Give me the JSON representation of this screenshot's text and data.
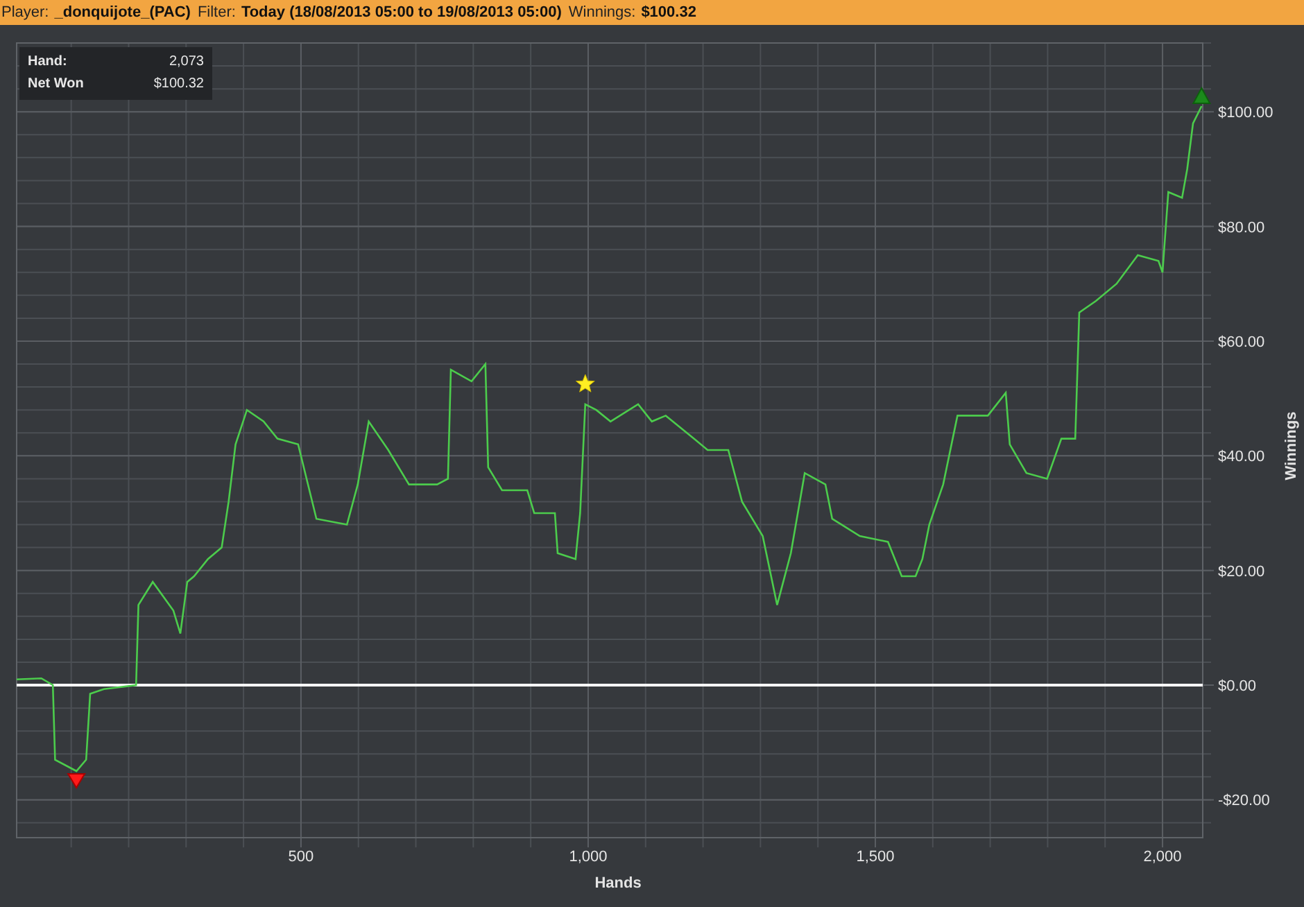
{
  "header": [
    {
      "label": "Player:",
      "value": "_donquijote_(PAC)"
    },
    {
      "label": "Filter:",
      "value": "Today (18/08/2013 05:00 to 19/08/2013 05:00)"
    },
    {
      "label": "Winnings:",
      "value": "$100.32"
    }
  ],
  "info_box": [
    {
      "label": "Hand:",
      "value": "2,073"
    },
    {
      "label": "Net Won",
      "value": "$100.32"
    }
  ],
  "chart_data": {
    "type": "line",
    "xlabel": "Hands",
    "ylabel": "Winnings",
    "xlim": [
      5,
      2070
    ],
    "ylim": [
      -26.6,
      112
    ],
    "xticks": [
      {
        "value": 500,
        "label": "500"
      },
      {
        "value": 1000,
        "label": "1,000"
      },
      {
        "value": 1500,
        "label": "1,500"
      },
      {
        "value": 2000,
        "label": "2,000"
      }
    ],
    "yticks": [
      {
        "value": -20,
        "label": "-$20.00"
      },
      {
        "value": 0,
        "label": "$0.00"
      },
      {
        "value": 20,
        "label": "$20.00"
      },
      {
        "value": 40,
        "label": "$40.00"
      },
      {
        "value": 60,
        "label": "$60.00"
      },
      {
        "value": 80,
        "label": "$80.00"
      },
      {
        "value": 100,
        "label": "$100.00"
      }
    ],
    "x": [
      5,
      48,
      68,
      72,
      109,
      126,
      133,
      157,
      213,
      217,
      242,
      278,
      290,
      302,
      314,
      338,
      362,
      374,
      386,
      406,
      435,
      459,
      495,
      527,
      580,
      599,
      618,
      652,
      688,
      737,
      756,
      761,
      797,
      821,
      826,
      850,
      894,
      906,
      942,
      947,
      978,
      986,
      995,
      1014,
      1039,
      1087,
      1111,
      1135,
      1184,
      1208,
      1244,
      1268,
      1304,
      1329,
      1353,
      1377,
      1413,
      1425,
      1473,
      1522,
      1546,
      1570,
      1582,
      1594,
      1618,
      1643,
      1696,
      1727,
      1734,
      1763,
      1799,
      1824,
      1848,
      1855,
      1884,
      1920,
      1957,
      1993,
      2000,
      2010,
      2034,
      2043,
      2053,
      2068
    ],
    "series": [
      {
        "color": "#4ccc4c",
        "values": [
          1,
          1.2,
          0,
          -13,
          -15,
          -13,
          -1.5,
          -0.7,
          0,
          14,
          18,
          13,
          9,
          18,
          19,
          22,
          24,
          32,
          42,
          48,
          46,
          43,
          42,
          29,
          28,
          35,
          46,
          41,
          35,
          35,
          36,
          55,
          53,
          56,
          38,
          34,
          34,
          30,
          30,
          23,
          22,
          30,
          49,
          48,
          46,
          49,
          46,
          47,
          43,
          41,
          41,
          32,
          26,
          14,
          23,
          37,
          35,
          29,
          26,
          25,
          19,
          19,
          22,
          28,
          35,
          47,
          47,
          51,
          42,
          37,
          36,
          43,
          43,
          65,
          67,
          70,
          75,
          74,
          72,
          86,
          85,
          90,
          98,
          101
        ]
      }
    ],
    "grid": true
  }
}
